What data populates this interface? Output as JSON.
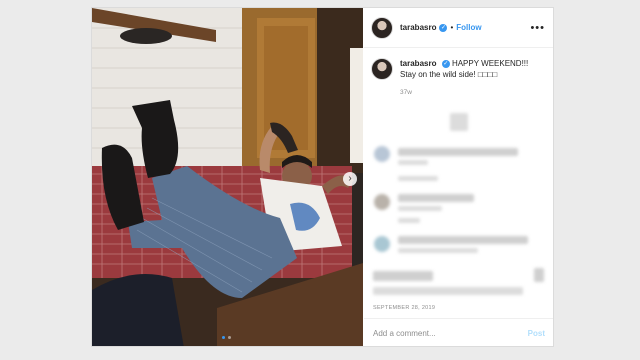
{
  "post": {
    "username": "tarabasro",
    "separator": "•",
    "follow_label": "Follow",
    "more_glyph": "•••",
    "verified_glyph": "✓",
    "caption_text": "HAPPY WEEKEND!!! Stay on the wild side! □□□□",
    "caption_age": "37w",
    "date": "SEPTEMBER 28, 2019",
    "comment_placeholder": "Add a comment...",
    "post_label": "Post",
    "next_glyph": "›",
    "image_count": 2,
    "active_image": 1
  },
  "colors": {
    "accent": "#3897f0",
    "post_disabled": "#b2dffc",
    "muted_text": "#8e8e8e"
  },
  "icons": [
    "verified-badge-icon",
    "more-options-icon",
    "next-arrow-icon"
  ]
}
